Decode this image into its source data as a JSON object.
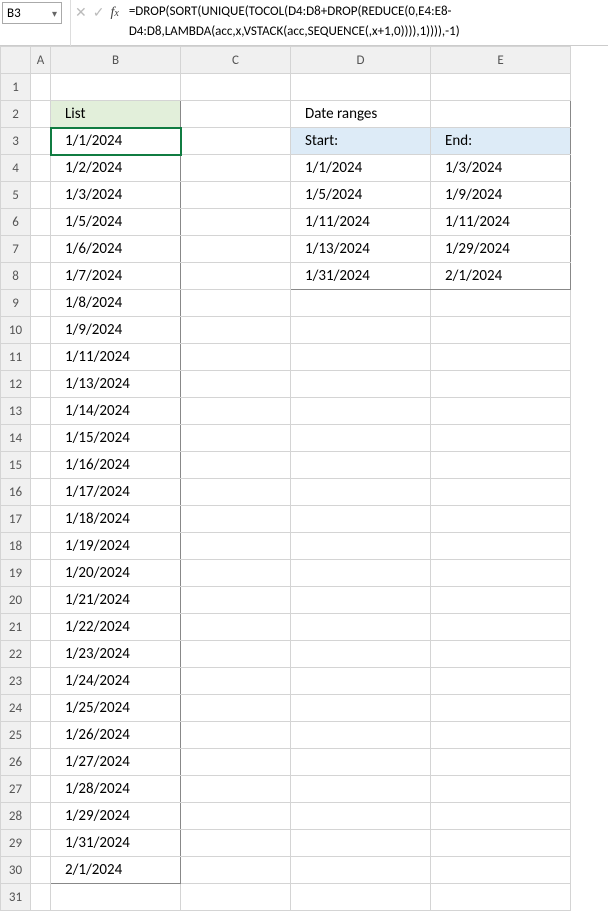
{
  "nameBox": "B3",
  "formula": "=DROP(SORT(UNIQUE(TOCOL(D4:D8+DROP(REDUCE(0,E4:E8-D4:D8,LAMBDA(acc,x,VSTACK(acc,SEQUENCE(,x+1,0)))),1)))),-1)",
  "columns": [
    "A",
    "B",
    "C",
    "D",
    "E"
  ],
  "list": {
    "header": "List",
    "items": [
      "1/1/2024",
      "1/2/2024",
      "1/3/2024",
      "1/5/2024",
      "1/6/2024",
      "1/7/2024",
      "1/8/2024",
      "1/9/2024",
      "1/11/2024",
      "1/13/2024",
      "1/14/2024",
      "1/15/2024",
      "1/16/2024",
      "1/17/2024",
      "1/18/2024",
      "1/19/2024",
      "1/20/2024",
      "1/21/2024",
      "1/22/2024",
      "1/23/2024",
      "1/24/2024",
      "1/25/2024",
      "1/26/2024",
      "1/27/2024",
      "1/28/2024",
      "1/29/2024",
      "1/31/2024",
      "2/1/2024"
    ]
  },
  "ranges": {
    "title": "Date ranges",
    "startHeader": "Start:",
    "endHeader": "End:",
    "rows": [
      {
        "start": "1/1/2024",
        "end": "1/3/2024"
      },
      {
        "start": "1/5/2024",
        "end": "1/9/2024"
      },
      {
        "start": "1/11/2024",
        "end": "1/11/2024"
      },
      {
        "start": "1/13/2024",
        "end": "1/29/2024"
      },
      {
        "start": "1/31/2024",
        "end": "2/1/2024"
      }
    ]
  },
  "rowCount": 31
}
